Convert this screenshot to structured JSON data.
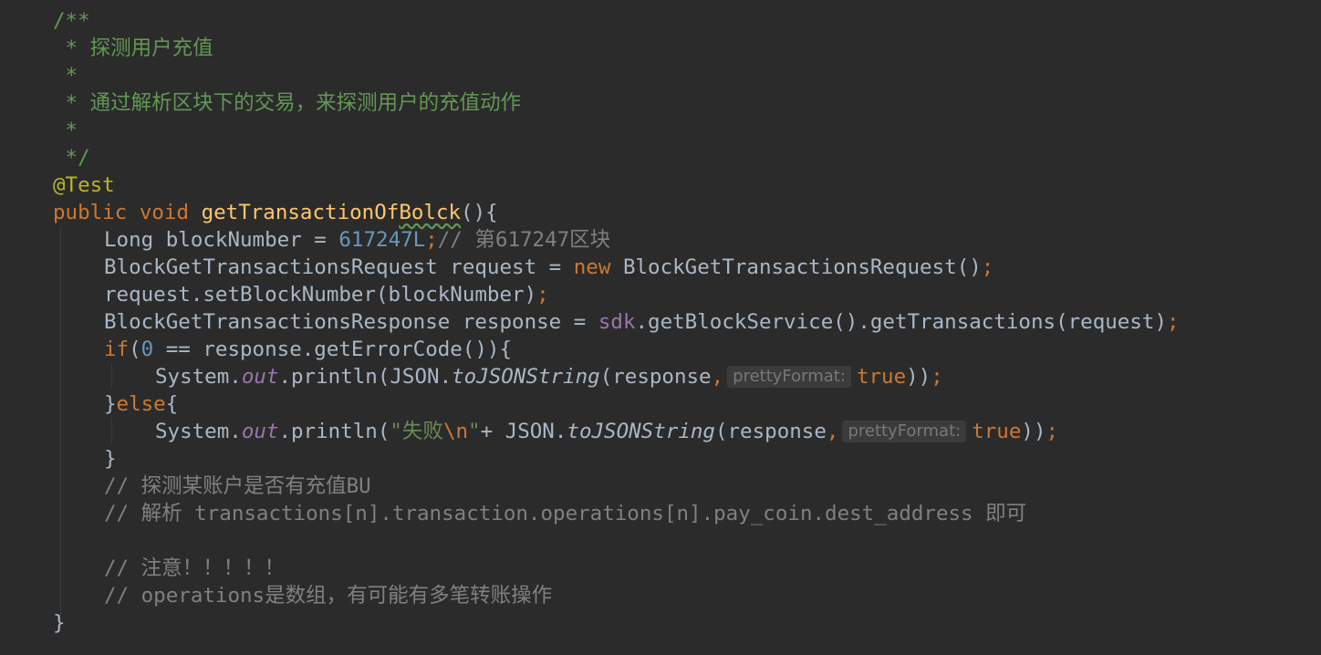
{
  "editor": {
    "language": "java",
    "colors": {
      "background": "#2b2b2b",
      "default_text": "#a9b7c6",
      "javadoc": "#629755",
      "line_comment": "#808080",
      "keyword": "#cc7832",
      "method_declaration": "#ffc66d",
      "number": "#6897bb",
      "string": "#6a8759",
      "annotation": "#bbb529",
      "static_field": "#9876aa",
      "parameter_hint_bg": "#3b3b3b",
      "parameter_hint_text": "#787878"
    },
    "javadoc": {
      "open": "/**",
      "line1": " * 探测用户充值",
      "line2": " *",
      "line3": " * 通过解析区块下的交易，来探测用户的充值动作",
      "line4": " *",
      "close": " */"
    },
    "annotation": "@Test",
    "method": {
      "modifiers": "public void ",
      "name_before_typo": "getTransactionOf",
      "name_typo": "Bolck",
      "params_open": "(){"
    },
    "statements": {
      "long_type": "Long blockNumber = ",
      "long_value": "617247L",
      "semicolon": ";",
      "long_comment": "// 第617247区块",
      "request_decl": "BlockGetTransactionsRequest request = ",
      "new_kw": "new",
      "request_ctor": " BlockGetTransactionsRequest()",
      "set_block": "request.setBlockNumber(blockNumber)",
      "response_decl": "BlockGetTransactionsResponse response = ",
      "sdk": "sdk",
      "response_call": ".getBlockService().getTransactions(request)",
      "if_kw": "if",
      "if_open": "(",
      "if_zero": "0",
      "if_cond": " == response.getErrorCode()){",
      "system": "System.",
      "out": "out",
      "println_open": ".println(JSON.",
      "to_json": "toJSONString",
      "response_arg": "(response",
      "comma": ",",
      "hint_label": "prettyFormat:",
      "true_kw": "true",
      "close_paren_semi": "))",
      "else_close": "}",
      "else_kw": "else",
      "else_open": "{",
      "println_str_open": ".println(",
      "fail_str_open": "\"失败",
      "fail_escape": "\\n",
      "fail_str_close": "\"",
      "plus_json": "+ JSON.",
      "close_brace": "}",
      "comment1": "// 探测某账户是否有充值BU",
      "comment2": "// 解析 transactions[n].transaction.operations[n].pay_coin.dest_address 即可",
      "comment3": "// 注意！！！！！",
      "comment4": "// operations是数组，有可能有多笔转账操作",
      "method_close": "}"
    }
  }
}
